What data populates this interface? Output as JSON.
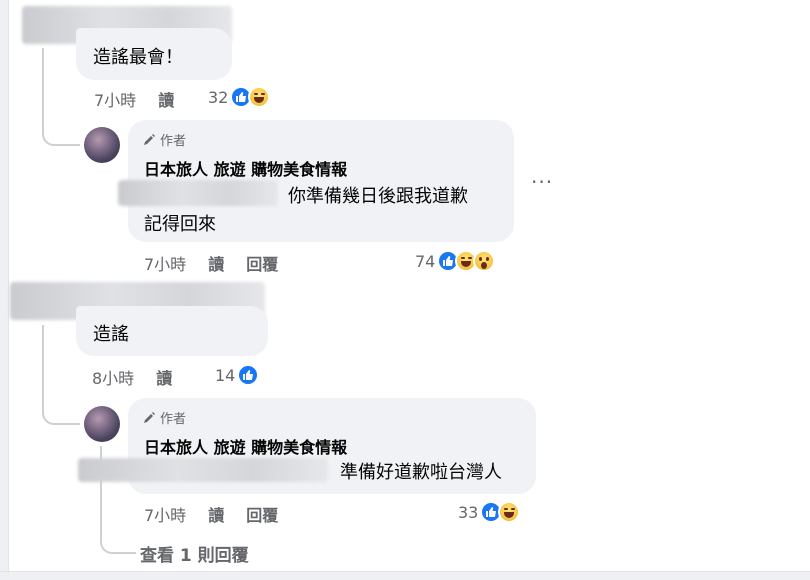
{
  "comments": [
    {
      "text": "造謠最會！",
      "time": "7小時",
      "action_like": "讀",
      "reaction_count": "32",
      "reactions": [
        "like-icon",
        "haha-icon"
      ],
      "reply": {
        "author_badge": "作者",
        "author_name": "日本旅人 旅遊 購物美食情報",
        "text_line1": "你準備幾日後跟我道歉",
        "text_line2": "記得回來",
        "time": "7小時",
        "action_like": "讀",
        "action_reply": "回覆",
        "reaction_count": "74",
        "reactions": [
          "like-icon",
          "haha-icon",
          "wow-icon"
        ],
        "more_menu": "···"
      }
    },
    {
      "text": "造謠",
      "time": "8小時",
      "action_like": "讀",
      "reaction_count": "14",
      "reactions": [
        "like-icon"
      ],
      "reply": {
        "author_badge": "作者",
        "author_name": "日本旅人 旅遊 購物美食情報",
        "text_line1": "準備好道歉啦台灣人",
        "time": "7小時",
        "action_like": "讀",
        "action_reply": "回覆",
        "reaction_count": "33",
        "reactions": [
          "like-icon",
          "haha-icon"
        ]
      }
    }
  ],
  "view_replies": "查看 1 則回覆",
  "colors": {
    "bubble": "#f0f2f5",
    "like": "#1877f2",
    "meta": "#65676b",
    "text": "#050505"
  }
}
